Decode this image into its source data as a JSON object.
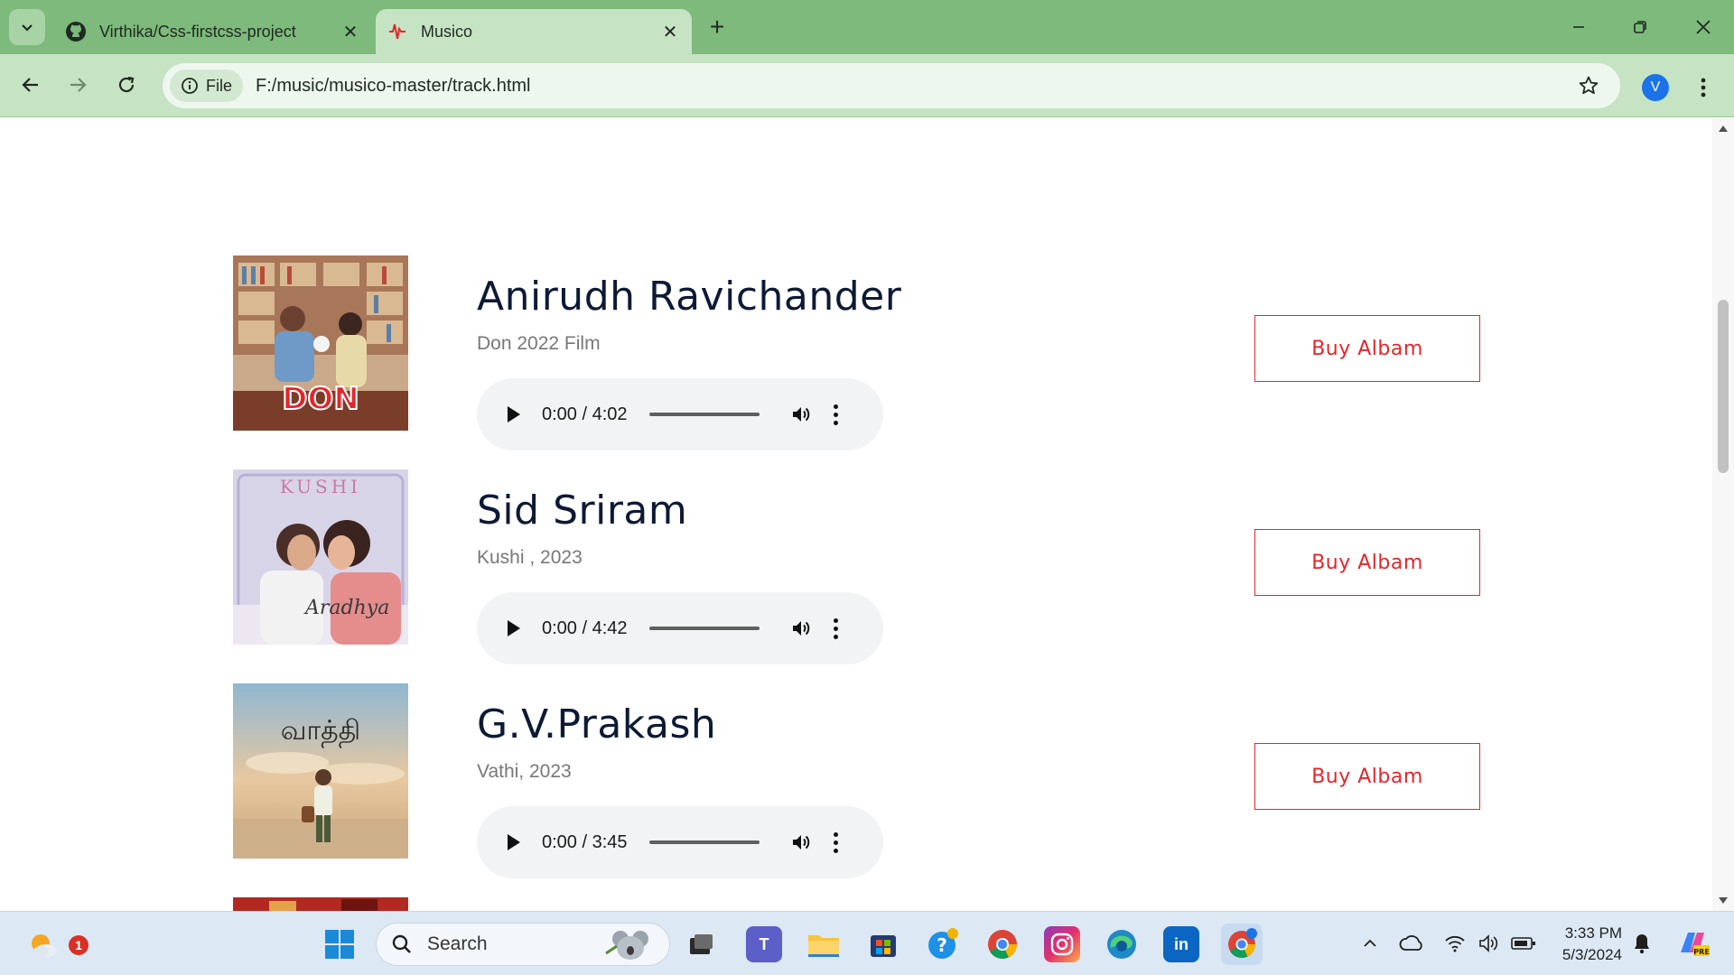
{
  "browser": {
    "tabs": [
      {
        "title": "Virthika/Css-firstcss-project",
        "active": false,
        "icon": "github-icon"
      },
      {
        "title": "Musico",
        "active": true,
        "icon": "musico-favicon"
      }
    ],
    "address_chip": "File",
    "url": "F:/music/musico-master/track.html",
    "profile_initial": "V",
    "theme_color": "#7dba7b"
  },
  "tracks": [
    {
      "artist": "Anirudh Ravichander",
      "album": "Don 2022 Film",
      "time": "0:00 / 4:02",
      "buy_label": "Buy Albam",
      "cover_text": "DON"
    },
    {
      "artist": "Sid Sriram",
      "album": "Kushi , 2023",
      "time": "0:00 / 4:42",
      "buy_label": "Buy Albam",
      "cover_text": "KUSHI"
    },
    {
      "artist": "G.V.Prakash",
      "album": "Vathi, 2023",
      "time": "0:00 / 3:45",
      "buy_label": "Buy Albam",
      "cover_text": "வாத்தி"
    }
  ],
  "colors": {
    "artist_heading": "#0d1a36",
    "buy_button": "#e3262b",
    "album_text": "#777777"
  },
  "taskbar": {
    "search_placeholder": "Search",
    "weather_badge": "1",
    "time": "3:33 PM",
    "date": "5/3/2024",
    "apps": [
      "start-icon",
      "task-view-icon",
      "teams-icon",
      "file-explorer-icon",
      "store-icon",
      "help-icon",
      "chrome-icon",
      "instagram-icon",
      "edge-icon",
      "linkedin-icon",
      "chrome-profile-icon"
    ]
  }
}
